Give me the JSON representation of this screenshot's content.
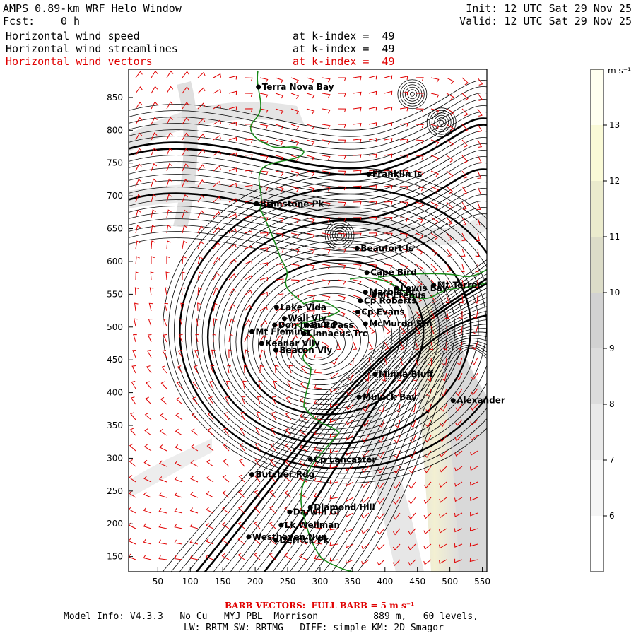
{
  "header": {
    "title": "AMPS 0.89-km WRF Helo Window",
    "fcst_label": "Fcst:",
    "fcst_value": "0 h",
    "init": "Init: 12 UTC Sat 29 Nov 25",
    "valid": "Valid: 12 UTC Sat 29 Nov 25"
  },
  "fields": [
    {
      "name": "Horizontal wind speed",
      "level": "at k-index =  49",
      "color": "#000000"
    },
    {
      "name": "Horizontal wind streamlines",
      "level": "at k-index =  49",
      "color": "#000000"
    },
    {
      "name": "Horizontal wind vectors",
      "level": "at k-index =  49",
      "color": "#e00000"
    }
  ],
  "axes": {
    "x_ticks": [
      50,
      100,
      150,
      200,
      250,
      300,
      350,
      400,
      450,
      500,
      550
    ],
    "y_ticks": [
      150,
      200,
      250,
      300,
      350,
      400,
      450,
      500,
      550,
      600,
      650,
      700,
      750,
      800,
      850
    ],
    "x_range": [
      5,
      557
    ],
    "y_range": [
      127,
      893
    ]
  },
  "colorbar": {
    "unit": "m s⁻¹",
    "ticks": [
      6,
      7,
      8,
      9,
      10,
      11,
      12,
      13
    ],
    "range": [
      5,
      14
    ],
    "colors": [
      "#ffffff",
      "#f5f5f5",
      "#e9e9e9",
      "#dcdcdc",
      "#d2d2d2",
      "#dcdcc8",
      "#ebebcd",
      "#fafad7",
      "#fffff0"
    ]
  },
  "sites": [
    {
      "name": "Terra Nova Bay",
      "x": 205,
      "y": 866
    },
    {
      "name": "Franklin Is",
      "x": 375,
      "y": 733
    },
    {
      "name": "Brimstone Pk",
      "x": 202,
      "y": 688
    },
    {
      "name": "Beaufort Is",
      "x": 357,
      "y": 620
    },
    {
      "name": "Cape Bird",
      "x": 372,
      "y": 583
    },
    {
      "name": "Lewis Bay",
      "x": 418,
      "y": 559
    },
    {
      "name": "Mt Terror",
      "x": 475,
      "y": 564
    },
    {
      "name": "Marble Pt",
      "x": 370,
      "y": 553
    },
    {
      "name": "Mt Erebus",
      "x": 383,
      "y": 548
    },
    {
      "name": "Cp Roberts",
      "x": 362,
      "y": 540
    },
    {
      "name": "Lake Vida",
      "x": 233,
      "y": 530
    },
    {
      "name": "Cp Evans",
      "x": 358,
      "y": 523
    },
    {
      "name": "Wall Vly",
      "x": 245,
      "y": 513
    },
    {
      "name": "Don Juan Pd",
      "x": 230,
      "y": 503
    },
    {
      "name": "Bull Pass",
      "x": 280,
      "y": 503
    },
    {
      "name": "McMurdo Stn",
      "x": 370,
      "y": 505
    },
    {
      "name": "Mt Fleming",
      "x": 195,
      "y": 493
    },
    {
      "name": "Linnaeus Trc",
      "x": 275,
      "y": 490
    },
    {
      "name": "Keanar Vlly",
      "x": 210,
      "y": 475
    },
    {
      "name": "Beacon Vly",
      "x": 232,
      "y": 465
    },
    {
      "name": "Minna Bluff",
      "x": 385,
      "y": 428
    },
    {
      "name": "Mulock Bay",
      "x": 360,
      "y": 393
    },
    {
      "name": "Alexander",
      "x": 505,
      "y": 388
    },
    {
      "name": "Cp Lancaster",
      "x": 285,
      "y": 298
    },
    {
      "name": "Butcher Rdg",
      "x": 195,
      "y": 275
    },
    {
      "name": "Darwin Gl",
      "x": 253,
      "y": 218
    },
    {
      "name": "Diamond Hill",
      "x": 285,
      "y": 225
    },
    {
      "name": "Lk Wellman",
      "x": 240,
      "y": 198
    },
    {
      "name": "Westhaven Nun",
      "x": 190,
      "y": 180
    },
    {
      "name": "Derrick Pk",
      "x": 232,
      "y": 175
    }
  ],
  "footer": {
    "barb_note": "BARB VECTORS:  FULL BARB = 5 m s⁻¹",
    "line1": "Model Info: V4.3.3   No Cu   MYJ PBL  Morrison          889 m,   60 levels,",
    "line2": "LW: RRTM SW: RRTMG   DIFF: simple KM: 2D Smagor"
  }
}
